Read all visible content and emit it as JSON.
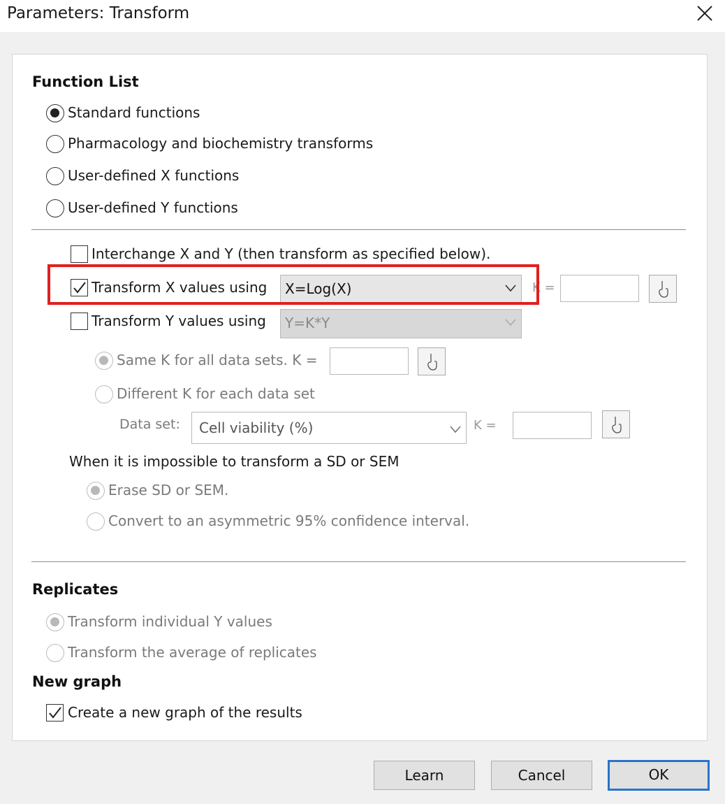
{
  "window": {
    "title": "Parameters: Transform"
  },
  "function_list": {
    "heading": "Function List",
    "options": [
      {
        "label": "Standard functions",
        "selected": true
      },
      {
        "label": "Pharmacology and biochemistry transforms",
        "selected": false
      },
      {
        "label": "User-defined X functions",
        "selected": false
      },
      {
        "label": "User-defined Y functions",
        "selected": false
      }
    ]
  },
  "transform": {
    "interchange_label": "Interchange X and Y (then transform as specified below).",
    "interchange_checked": false,
    "x_label": "Transform X values using",
    "x_checked": true,
    "x_function": "X=Log(X)",
    "x_k_label": "K =",
    "x_k_value": "",
    "y_label": "Transform Y values using",
    "y_checked": false,
    "y_function": "Y=K*Y",
    "same_k_label": "Same K for all data sets. K =",
    "same_k_value": "",
    "different_k_label": "Different K for each data set",
    "dataset_label": "Data set:",
    "dataset_value": "Cell viability (%)",
    "dataset_k_label": "K =",
    "dataset_k_value": "",
    "impossible_heading": "When it is impossible to transform a SD or SEM",
    "erase_label": "Erase SD or SEM.",
    "convert_label": "Convert to an asymmetric 95% confidence interval."
  },
  "replicates": {
    "heading": "Replicates",
    "individual_label": "Transform individual Y values",
    "average_label": "Transform the average of replicates"
  },
  "new_graph": {
    "heading": "New graph",
    "create_label": "Create a new graph of the results",
    "create_checked": true
  },
  "buttons": {
    "learn": "Learn",
    "cancel": "Cancel",
    "ok": "OK"
  },
  "colors": {
    "highlight": "#e02020",
    "default_button_border": "#2a73c9"
  }
}
